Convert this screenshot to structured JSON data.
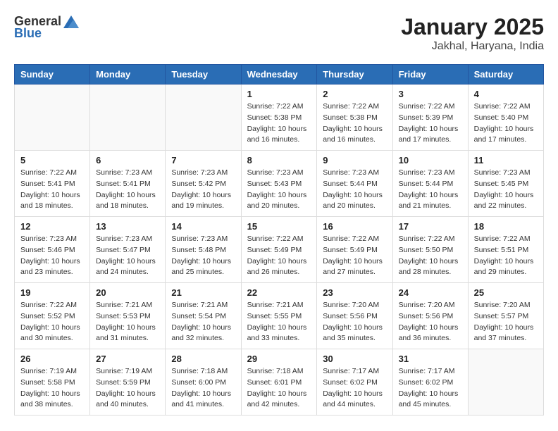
{
  "header": {
    "logo_general": "General",
    "logo_blue": "Blue",
    "title": "January 2025",
    "subtitle": "Jakhal, Haryana, India"
  },
  "calendar": {
    "days_of_week": [
      "Sunday",
      "Monday",
      "Tuesday",
      "Wednesday",
      "Thursday",
      "Friday",
      "Saturday"
    ],
    "weeks": [
      [
        {
          "day": "",
          "info": ""
        },
        {
          "day": "",
          "info": ""
        },
        {
          "day": "",
          "info": ""
        },
        {
          "day": "1",
          "info": "Sunrise: 7:22 AM\nSunset: 5:38 PM\nDaylight: 10 hours\nand 16 minutes."
        },
        {
          "day": "2",
          "info": "Sunrise: 7:22 AM\nSunset: 5:38 PM\nDaylight: 10 hours\nand 16 minutes."
        },
        {
          "day": "3",
          "info": "Sunrise: 7:22 AM\nSunset: 5:39 PM\nDaylight: 10 hours\nand 17 minutes."
        },
        {
          "day": "4",
          "info": "Sunrise: 7:22 AM\nSunset: 5:40 PM\nDaylight: 10 hours\nand 17 minutes."
        }
      ],
      [
        {
          "day": "5",
          "info": "Sunrise: 7:22 AM\nSunset: 5:41 PM\nDaylight: 10 hours\nand 18 minutes."
        },
        {
          "day": "6",
          "info": "Sunrise: 7:23 AM\nSunset: 5:41 PM\nDaylight: 10 hours\nand 18 minutes."
        },
        {
          "day": "7",
          "info": "Sunrise: 7:23 AM\nSunset: 5:42 PM\nDaylight: 10 hours\nand 19 minutes."
        },
        {
          "day": "8",
          "info": "Sunrise: 7:23 AM\nSunset: 5:43 PM\nDaylight: 10 hours\nand 20 minutes."
        },
        {
          "day": "9",
          "info": "Sunrise: 7:23 AM\nSunset: 5:44 PM\nDaylight: 10 hours\nand 20 minutes."
        },
        {
          "day": "10",
          "info": "Sunrise: 7:23 AM\nSunset: 5:44 PM\nDaylight: 10 hours\nand 21 minutes."
        },
        {
          "day": "11",
          "info": "Sunrise: 7:23 AM\nSunset: 5:45 PM\nDaylight: 10 hours\nand 22 minutes."
        }
      ],
      [
        {
          "day": "12",
          "info": "Sunrise: 7:23 AM\nSunset: 5:46 PM\nDaylight: 10 hours\nand 23 minutes."
        },
        {
          "day": "13",
          "info": "Sunrise: 7:23 AM\nSunset: 5:47 PM\nDaylight: 10 hours\nand 24 minutes."
        },
        {
          "day": "14",
          "info": "Sunrise: 7:23 AM\nSunset: 5:48 PM\nDaylight: 10 hours\nand 25 minutes."
        },
        {
          "day": "15",
          "info": "Sunrise: 7:22 AM\nSunset: 5:49 PM\nDaylight: 10 hours\nand 26 minutes."
        },
        {
          "day": "16",
          "info": "Sunrise: 7:22 AM\nSunset: 5:49 PM\nDaylight: 10 hours\nand 27 minutes."
        },
        {
          "day": "17",
          "info": "Sunrise: 7:22 AM\nSunset: 5:50 PM\nDaylight: 10 hours\nand 28 minutes."
        },
        {
          "day": "18",
          "info": "Sunrise: 7:22 AM\nSunset: 5:51 PM\nDaylight: 10 hours\nand 29 minutes."
        }
      ],
      [
        {
          "day": "19",
          "info": "Sunrise: 7:22 AM\nSunset: 5:52 PM\nDaylight: 10 hours\nand 30 minutes."
        },
        {
          "day": "20",
          "info": "Sunrise: 7:21 AM\nSunset: 5:53 PM\nDaylight: 10 hours\nand 31 minutes."
        },
        {
          "day": "21",
          "info": "Sunrise: 7:21 AM\nSunset: 5:54 PM\nDaylight: 10 hours\nand 32 minutes."
        },
        {
          "day": "22",
          "info": "Sunrise: 7:21 AM\nSunset: 5:55 PM\nDaylight: 10 hours\nand 33 minutes."
        },
        {
          "day": "23",
          "info": "Sunrise: 7:20 AM\nSunset: 5:56 PM\nDaylight: 10 hours\nand 35 minutes."
        },
        {
          "day": "24",
          "info": "Sunrise: 7:20 AM\nSunset: 5:56 PM\nDaylight: 10 hours\nand 36 minutes."
        },
        {
          "day": "25",
          "info": "Sunrise: 7:20 AM\nSunset: 5:57 PM\nDaylight: 10 hours\nand 37 minutes."
        }
      ],
      [
        {
          "day": "26",
          "info": "Sunrise: 7:19 AM\nSunset: 5:58 PM\nDaylight: 10 hours\nand 38 minutes."
        },
        {
          "day": "27",
          "info": "Sunrise: 7:19 AM\nSunset: 5:59 PM\nDaylight: 10 hours\nand 40 minutes."
        },
        {
          "day": "28",
          "info": "Sunrise: 7:18 AM\nSunset: 6:00 PM\nDaylight: 10 hours\nand 41 minutes."
        },
        {
          "day": "29",
          "info": "Sunrise: 7:18 AM\nSunset: 6:01 PM\nDaylight: 10 hours\nand 42 minutes."
        },
        {
          "day": "30",
          "info": "Sunrise: 7:17 AM\nSunset: 6:02 PM\nDaylight: 10 hours\nand 44 minutes."
        },
        {
          "day": "31",
          "info": "Sunrise: 7:17 AM\nSunset: 6:02 PM\nDaylight: 10 hours\nand 45 minutes."
        },
        {
          "day": "",
          "info": ""
        }
      ]
    ]
  }
}
